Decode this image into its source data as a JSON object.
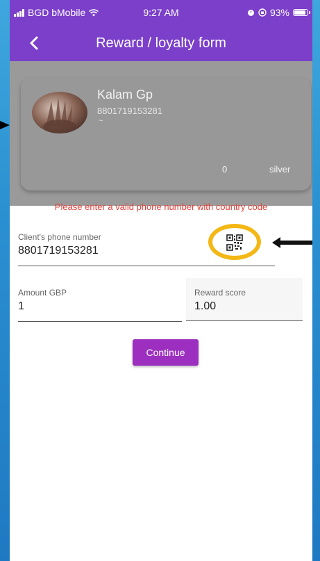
{
  "status_bar": {
    "carrier": "BGD bMobile",
    "time": "9:27 AM",
    "battery": "93%",
    "battery_level": 0.93
  },
  "app_bar": {
    "title": "Reward / loyalty form",
    "back_icon": "chevron-left-icon"
  },
  "customer_card": {
    "name": "Kalam Gp",
    "phone": "8801719153281",
    "note": "~",
    "points": "0",
    "tier": "silver"
  },
  "error_message": "Please enter a valid phone number with country code",
  "form": {
    "phone_label": "Client's phone number",
    "phone_value": "8801719153281",
    "qr_icon": "qr-code-icon",
    "amount_label": "Amount GBP",
    "amount_value": "1",
    "reward_label": "Reward score",
    "reward_value": "1.00"
  },
  "continue_label": "Continue",
  "colors": {
    "app_bar": "#7b3fc9",
    "button": "#9c2fbf",
    "error": "#e0403a",
    "highlight_ring": "#f3b716"
  }
}
